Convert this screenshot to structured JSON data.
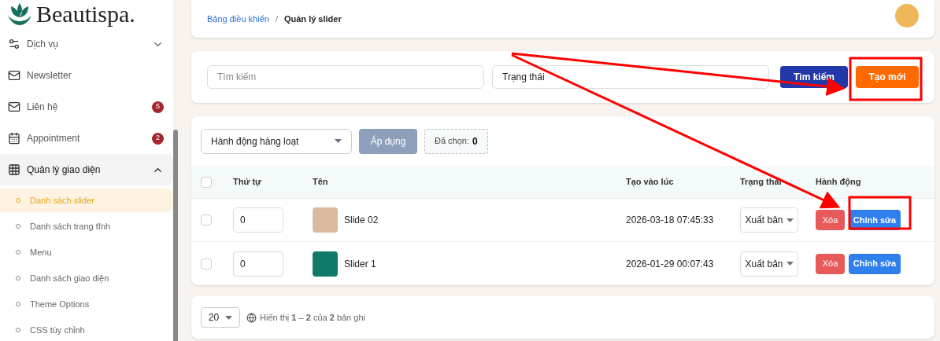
{
  "sidebar": {
    "logo": "Beautispa.",
    "items": [
      {
        "label": "Dịch vụ",
        "expanded": false
      },
      {
        "label": "Newsletter"
      },
      {
        "label": "Liên hệ",
        "badge": "5"
      },
      {
        "label": "Appointment",
        "badge": "2"
      },
      {
        "label": "Quản lý giao diện",
        "expanded": true,
        "children": [
          {
            "label": "Danh sách slider",
            "selected": true
          },
          {
            "label": "Danh sách trang tĩnh",
            "selected": false
          },
          {
            "label": "Menu",
            "selected": false
          },
          {
            "label": "Danh sách giao diện",
            "selected": false
          },
          {
            "label": "Theme Options",
            "selected": false
          },
          {
            "label": "CSS tùy chỉnh",
            "selected": false
          }
        ]
      }
    ]
  },
  "breadcrumb_separator": "/",
  "breadcrumb": [
    {
      "label": "Bảng điều khiển",
      "link": true
    },
    {
      "label": "Quản lý slider",
      "link": false
    }
  ],
  "filters": {
    "search": {
      "placeholder": "Tìm kiếm"
    },
    "status": {
      "value": "Trạng thái"
    },
    "search_button": "Tìm kiếm",
    "create_button": "Tạo mới"
  },
  "bulk": {
    "action": "Hành động hàng loạt",
    "apply": "Áp dụng",
    "apply_disabled": true,
    "selected_label": "Đã chọn:",
    "selected_count": "0"
  },
  "table": {
    "columns": [
      "Thứ tự",
      "Tên",
      "Tạo vào lúc",
      "Trạng thái",
      "Hành động"
    ],
    "all_checked": false,
    "rows": [
      {
        "checked": false,
        "order": "0",
        "name": "Slide 02",
        "created": "2026-03-18 07:45:33",
        "status": "Xuất bản",
        "delete": "Xóa",
        "edit": "Chỉnh sửa"
      },
      {
        "checked": false,
        "order": "0",
        "name": "Slider 1",
        "created": "2026-01-29 00:07:43",
        "status": "Xuất bản",
        "delete": "Xóa",
        "edit": "Chỉnh sửa"
      }
    ]
  },
  "pagination": {
    "per_page": "20",
    "summary": "Hiển thị **1** – **2** của **2** bản ghi"
  }
}
